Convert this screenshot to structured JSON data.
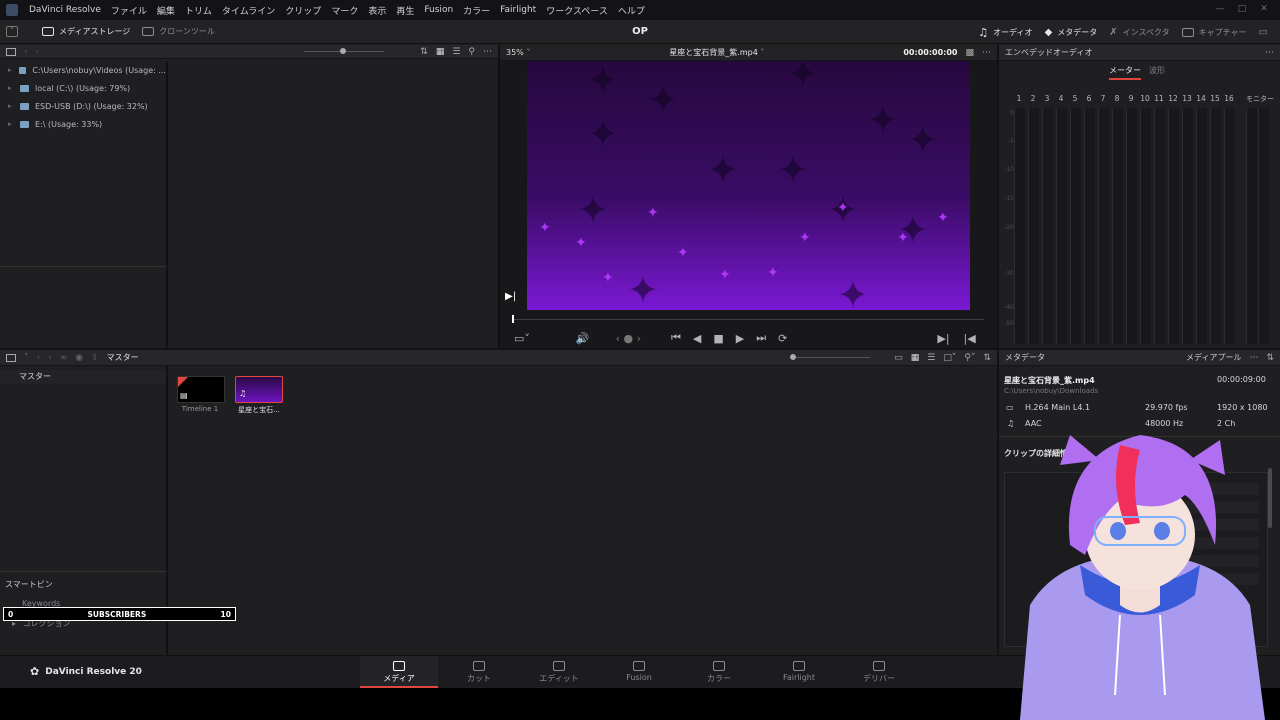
{
  "app": {
    "title": "DaVinci Resolve",
    "version_label": "DaVinci Resolve 20"
  },
  "menu": [
    "ファイル",
    "編集",
    "トリム",
    "タイムライン",
    "クリップ",
    "マーク",
    "表示",
    "再生",
    "Fusion",
    "カラー",
    "Fairlight",
    "ワークスペース",
    "ヘルプ"
  ],
  "toolbar": {
    "media_storage": "メディアストレージ",
    "clone_tool": "クローンツール",
    "project_title": "OP",
    "audio": "オーディオ",
    "metadata": "メタデータ",
    "inspector": "インスペクタ",
    "capture": "キャプチャー"
  },
  "storage": {
    "items": [
      "C:\\Users\\nobuy\\Videos (Usage: ...",
      "local (C:\\) (Usage: 79%)",
      "ESD-USB (D:\\) (Usage: 32%)",
      "E:\\ (Usage: 33%)"
    ]
  },
  "viewer": {
    "zoom": "35%",
    "clip_name": "星座と宝石背景_紫.mp4",
    "timecode": "00:00:00:00"
  },
  "audio_panel": {
    "title": "エンベデッドオーディオ",
    "tab_meter": "メーター",
    "tab_waveform": "波形",
    "monitor": "モニター",
    "channels": [
      "1",
      "2",
      "3",
      "4",
      "5",
      "6",
      "7",
      "8",
      "9",
      "10",
      "11",
      "12",
      "13",
      "14",
      "15",
      "16"
    ],
    "db_scale": [
      "0",
      "-5",
      "-10",
      "-15",
      "-20",
      "-30",
      "-40",
      "-50"
    ]
  },
  "media_pool": {
    "bin": "マスター",
    "root_label": "マスター",
    "clips": [
      {
        "label": "Timeline 1"
      },
      {
        "label": "星座と宝石..."
      }
    ],
    "smart_bins": "スマートビン",
    "keywords": "Keywords",
    "collections": "コレクション"
  },
  "metadata_panel": {
    "title": "メタデータ",
    "pool_label": "メディアプール",
    "file_name": "星座と宝石背景_紫.mp4",
    "duration": "00:00:09:00",
    "path": "C:\\Users\\nobuy\\Downloads",
    "video_codec": "H.264 Main L4.1",
    "fps": "29.970 fps",
    "resolution": "1920 x 1080",
    "audio_codec": "AAC",
    "sample_rate": "48000 Hz",
    "channels": "2 Ch",
    "clip_details": "クリップの詳細情報"
  },
  "overlay": {
    "min": "0",
    "label": "SUBSCRIBERS",
    "max": "10"
  },
  "pages": [
    "メディア",
    "カット",
    "エディット",
    "Fusion",
    "カラー",
    "Fairlight",
    "デリバー"
  ],
  "colors": {
    "accent": "#e0463f",
    "bg": "#1f1f22",
    "viewer_purple": "#7a18d4"
  }
}
